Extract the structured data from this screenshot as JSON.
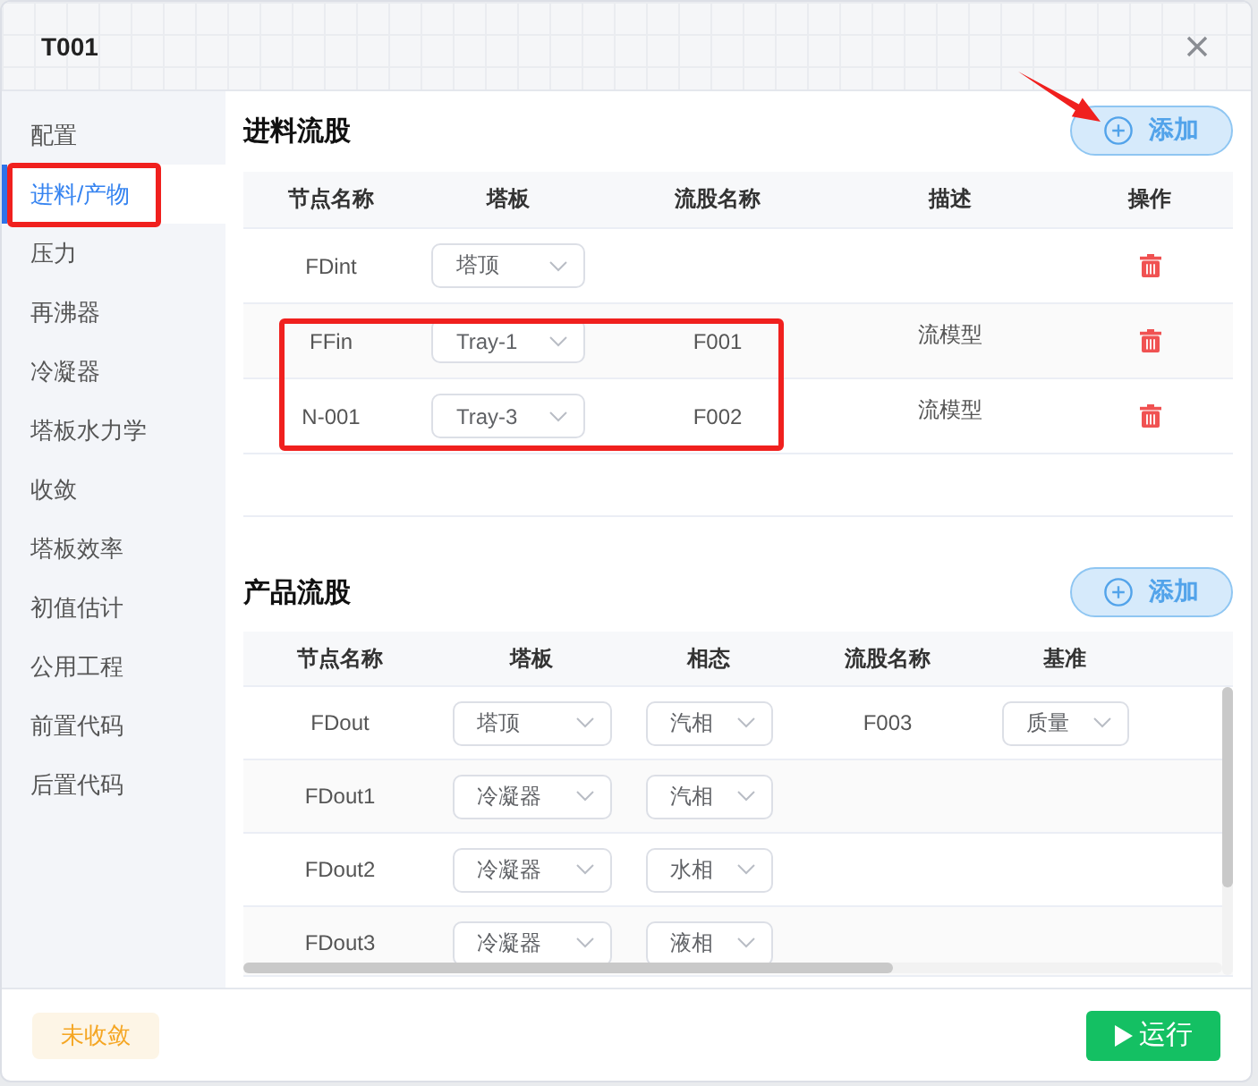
{
  "window": {
    "title": "T001"
  },
  "sidebar": {
    "items": [
      {
        "label": "配置",
        "selected": false,
        "highlighted": false
      },
      {
        "label": "进料/产物",
        "selected": true,
        "highlighted": true
      },
      {
        "label": "压力",
        "selected": false,
        "highlighted": false
      },
      {
        "label": "再沸器",
        "selected": false,
        "highlighted": false
      },
      {
        "label": "冷凝器",
        "selected": false,
        "highlighted": false
      },
      {
        "label": "塔板水力学",
        "selected": false,
        "highlighted": false
      },
      {
        "label": "收敛",
        "selected": false,
        "highlighted": false
      },
      {
        "label": "塔板效率",
        "selected": false,
        "highlighted": false
      },
      {
        "label": "初值估计",
        "selected": false,
        "highlighted": false
      },
      {
        "label": "公用工程",
        "selected": false,
        "highlighted": false
      },
      {
        "label": "前置代码",
        "selected": false,
        "highlighted": false
      },
      {
        "label": "后置代码",
        "selected": false,
        "highlighted": false
      }
    ]
  },
  "feed_section": {
    "title": "进料流股",
    "add_button": {
      "label": "添加",
      "pointed": true
    },
    "table": {
      "columns": [
        "节点名称",
        "塔板",
        "流股名称",
        "描述",
        "操作"
      ],
      "rows": [
        {
          "node": "FDint",
          "tray": "塔顶",
          "highlighted": false
        },
        {
          "node": "FFin",
          "tray": "Tray-1",
          "stream": "F001",
          "description": "流模型",
          "highlighted": true
        },
        {
          "node": "N-001",
          "tray": "Tray-3",
          "stream": "F002",
          "description": "流模型",
          "highlighted": true
        }
      ]
    }
  },
  "product_section": {
    "title": "产品流股",
    "add_button": {
      "label": "添加",
      "pointed": false
    },
    "table": {
      "columns": [
        "节点名称",
        "塔板",
        "相态",
        "流股名称",
        "基准"
      ],
      "rows": [
        {
          "node": "FDout",
          "tray": "塔顶",
          "phase": "汽相",
          "stream": "F003",
          "basis": "质量"
        },
        {
          "node": "FDout1",
          "tray": "冷凝器",
          "phase": "汽相"
        },
        {
          "node": "FDout2",
          "tray": "冷凝器",
          "phase": "水相"
        },
        {
          "node": "FDout3",
          "tray": "冷凝器",
          "phase": "液相"
        }
      ]
    }
  },
  "status_bar": {
    "status": {
      "label": "未收敛",
      "kind": "warning"
    },
    "run_button": {
      "label": "运行"
    }
  }
}
